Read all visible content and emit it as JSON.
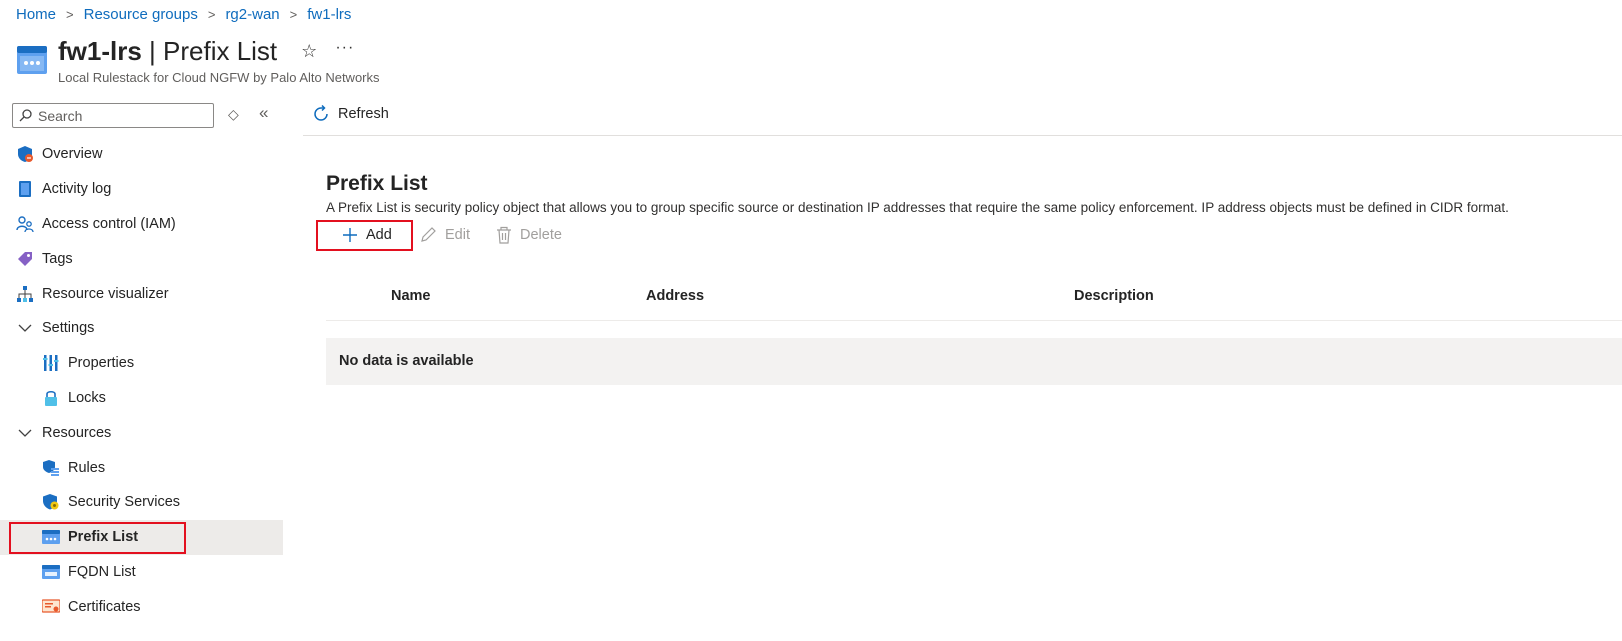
{
  "breadcrumb": [
    "Home",
    "Resource groups",
    "rg2-wan",
    "fw1-lrs"
  ],
  "header": {
    "resource_name": "fw1-lrs",
    "separator": " | ",
    "page_name": "Prefix List",
    "subtitle": "Local Rulestack for Cloud NGFW by Palo Alto Networks",
    "star_icon": "☆",
    "more_icon": "···"
  },
  "sidebar": {
    "search_placeholder": "Search",
    "updown_icon": "◇",
    "collapse_icon": "«",
    "items": [
      {
        "label": "Overview",
        "icon": "overview-icon"
      },
      {
        "label": "Activity log",
        "icon": "activity-log-icon"
      },
      {
        "label": "Access control (IAM)",
        "icon": "iam-icon"
      },
      {
        "label": "Tags",
        "icon": "tag-icon"
      },
      {
        "label": "Resource visualizer",
        "icon": "visualizer-icon"
      },
      {
        "label": "Settings",
        "icon": "chevron-down-icon"
      },
      {
        "label": "Properties",
        "icon": "properties-icon"
      },
      {
        "label": "Locks",
        "icon": "lock-icon"
      },
      {
        "label": "Resources",
        "icon": "chevron-down-icon"
      },
      {
        "label": "Rules",
        "icon": "rules-icon"
      },
      {
        "label": "Security Services",
        "icon": "security-services-icon"
      },
      {
        "label": "Prefix List",
        "icon": "prefix-list-icon"
      },
      {
        "label": "FQDN List",
        "icon": "fqdn-list-icon"
      },
      {
        "label": "Certificates",
        "icon": "certificate-icon"
      }
    ]
  },
  "commandbar": {
    "refresh_label": "Refresh"
  },
  "main": {
    "title": "Prefix List",
    "description": "A Prefix List is security policy object that allows you to group specific source or destination IP addresses that require the same policy enforcement. IP address objects must be defined in CIDR format.",
    "toolbar": {
      "add_label": "Add",
      "edit_label": "Edit",
      "delete_label": "Delete"
    },
    "columns": [
      "Name",
      "Address",
      "Description"
    ],
    "empty_text": "No data is available"
  },
  "colors": {
    "link": "#0f6cbd",
    "highlight": "#e3101f",
    "selected_bg": "#edebe9",
    "disabled": "#a19f9d"
  }
}
